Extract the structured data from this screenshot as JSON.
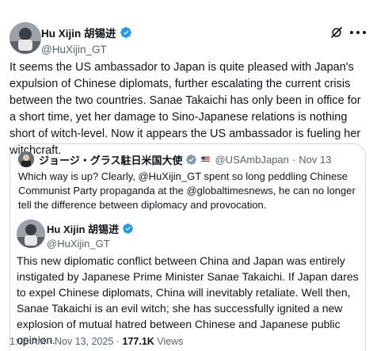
{
  "post": {
    "author": {
      "name": "Hu Xijin 胡锡进",
      "handle": "@HuXijin_GT"
    },
    "text": "It seems the US ambassador to Japan is quite pleased with Japan's expulsion of Chinese diplomats, further escalating the current crisis between the two countries. Sanae Takaichi has only been in office for a short time, yet her damage to Sino-Japanese relations is nothing short of witch-level. Now it appears the US ambassador is fueling her witchcraft.",
    "icons": {
      "verified": "verified-badge-icon",
      "grok": "grok-icon",
      "more": "more-icon"
    }
  },
  "quote": {
    "author": {
      "name": "ジョージ・グラス駐日米国大使",
      "handle": "@USAmbJapan",
      "separator": "·",
      "date": "Nov 13"
    },
    "text": "Which way is up? Clearly, @HuXijin_GT spent so long peddling Chinese Communist Party propaganda at the @globaltimesnews, he can no longer tell the difference between diplomacy and provocation."
  },
  "inner": {
    "author": {
      "name": "Hu Xijin 胡锡进",
      "handle": "@HuXijin_GT"
    },
    "text": "This new diplomatic conflict between China and Japan was entirely instigated by Japanese Prime Minister Sanae Takaichi. If Japan dares to expel Chinese diplomats, China will inevitably retaliate. Well then, Sanae Takaichi is an evil witch; she has successfully ignited a new explosion of mutual hatred between Chinese and Japanese public opinion."
  },
  "footer": {
    "time": "1:08 AM",
    "sep1": "·",
    "date": "Nov 13, 2025",
    "sep2": "·",
    "views_count": "177.1K",
    "views_label": "Views"
  },
  "colors": {
    "text": "#0f1419",
    "secondary": "#536471",
    "verified": "#1d9bf0",
    "border": "#cfd9de"
  }
}
